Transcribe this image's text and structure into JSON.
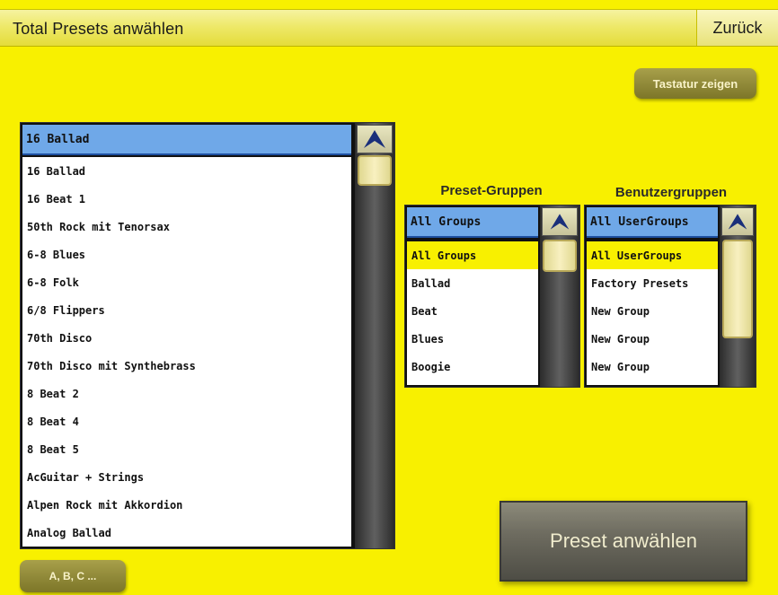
{
  "header": {
    "title": "Total Presets anwählen",
    "back_label": "Zurück"
  },
  "keyboard_button": "Tastatur zeigen",
  "alpha_button": "A, B, C ...",
  "preset_list": {
    "selected": "16 Ballad",
    "items": [
      "16 Ballad",
      "16 Beat 1",
      "50th Rock mit Tenorsax",
      "6-8 Blues",
      "6-8 Folk",
      "6/8 Flippers",
      "70th Disco",
      "70th Disco mit Synthebrass",
      "8 Beat 2",
      "8 Beat 4",
      "8 Beat 5",
      "AcGuitar + Strings",
      "Alpen Rock mit Akkordion",
      "Analog Ballad"
    ]
  },
  "preset_groups": {
    "label": "Preset-Gruppen",
    "selected": "All Groups",
    "items": [
      "All Groups",
      "Ballad",
      "Beat",
      "Blues",
      "Boogie"
    ]
  },
  "user_groups": {
    "label": "Benutzergruppen",
    "selected": "All UserGroups",
    "items": [
      "All UserGroups",
      "Factory Presets",
      "New Group",
      "New Group",
      "New Group"
    ]
  },
  "select_button": "Preset anwählen",
  "colors": {
    "background": "#f8f000",
    "selection_header": "#6fa8e8",
    "highlight_row": "#f8f000",
    "button_olive": "#8f8838",
    "button_dark": "#6e6c60"
  },
  "icons": {
    "scroll_up": "scroll-up-arrow-icon"
  }
}
